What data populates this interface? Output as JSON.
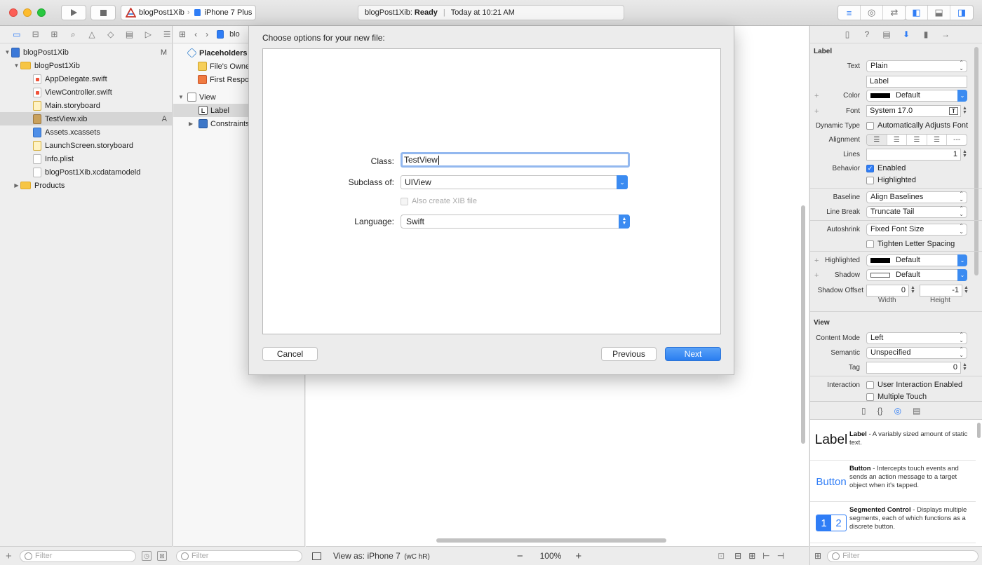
{
  "toolbar": {
    "scheme_project": "blogPost1Xib",
    "scheme_device": "iPhone 7 Plus",
    "activity_project": "blogPost1Xib:",
    "activity_status": "Ready",
    "activity_time": "Today at 10:21 AM"
  },
  "navigator": {
    "items": [
      {
        "label": "blogPost1Xib",
        "badge": "M"
      },
      {
        "label": "blogPost1Xib"
      },
      {
        "label": "AppDelegate.swift"
      },
      {
        "label": "ViewController.swift"
      },
      {
        "label": "Main.storyboard"
      },
      {
        "label": "TestView.xib",
        "badge": "A"
      },
      {
        "label": "Assets.xcassets"
      },
      {
        "label": "LaunchScreen.storyboard"
      },
      {
        "label": "Info.plist"
      },
      {
        "label": "blogPost1Xib.xcdatamodeld"
      },
      {
        "label": "Products"
      }
    ],
    "filter_placeholder": "Filter"
  },
  "outline": {
    "jump_crumb": "blo",
    "placeholders": "Placeholders",
    "files_owner": "File's Owne",
    "first_responder": "First Respo",
    "view": "View",
    "label": "Label",
    "constraints": "Constraints",
    "filter_placeholder": "Filter"
  },
  "canvas": {
    "view_as": "View as: iPhone 7",
    "size_class": "(wC hR)",
    "zoom": "100%"
  },
  "sheet": {
    "title": "Choose options for your new file:",
    "class_label": "Class:",
    "class_value": "TestView",
    "subclass_label": "Subclass of:",
    "subclass_value": "UIView",
    "xib_checkbox": "Also create XIB file",
    "language_label": "Language:",
    "language_value": "Swift",
    "cancel": "Cancel",
    "previous": "Previous",
    "next": "Next"
  },
  "inspector": {
    "label_section": "Label",
    "text_label": "Text",
    "text_value": "Plain",
    "text_content": "Label",
    "color_label": "Color",
    "color_value": "Default",
    "font_label": "Font",
    "font_value": "System 17.0",
    "dynamic_type_label": "Dynamic Type",
    "dynamic_type_value": "Automatically Adjusts Font",
    "alignment_label": "Alignment",
    "lines_label": "Lines",
    "lines_value": "1",
    "behavior_label": "Behavior",
    "enabled": "Enabled",
    "highlighted": "Highlighted",
    "baseline_label": "Baseline",
    "baseline_value": "Align Baselines",
    "line_break_label": "Line Break",
    "line_break_value": "Truncate Tail",
    "autoshrink_label": "Autoshrink",
    "autoshrink_value": "Fixed Font Size",
    "tighten": "Tighten Letter Spacing",
    "highlighted_label": "Highlighted",
    "highlighted_value": "Default",
    "shadow_label": "Shadow",
    "shadow_value": "Default",
    "shadow_offset_label": "Shadow Offset",
    "shadow_width": "0",
    "shadow_height": "-1",
    "width_caption": "Width",
    "height_caption": "Height",
    "view_section": "View",
    "content_mode_label": "Content Mode",
    "content_mode_value": "Left",
    "semantic_label": "Semantic",
    "semantic_value": "Unspecified",
    "tag_label": "Tag",
    "tag_value": "0",
    "interaction_label": "Interaction",
    "user_interaction": "User Interaction Enabled",
    "multiple_touch": "Multiple Touch",
    "filter_placeholder": "Filter"
  },
  "library": [
    {
      "icon_text": "Label",
      "name": "Label",
      "desc": " - A variably sized amount of static text."
    },
    {
      "icon_text": "Button",
      "name": "Button",
      "desc": " - Intercepts touch events and sends an action message to a target object when it's tapped."
    },
    {
      "icon_seg1": "1",
      "icon_seg2": "2",
      "name": "Segmented Control",
      "desc": " - Displays multiple segments, each of which functions as a discrete button."
    }
  ]
}
